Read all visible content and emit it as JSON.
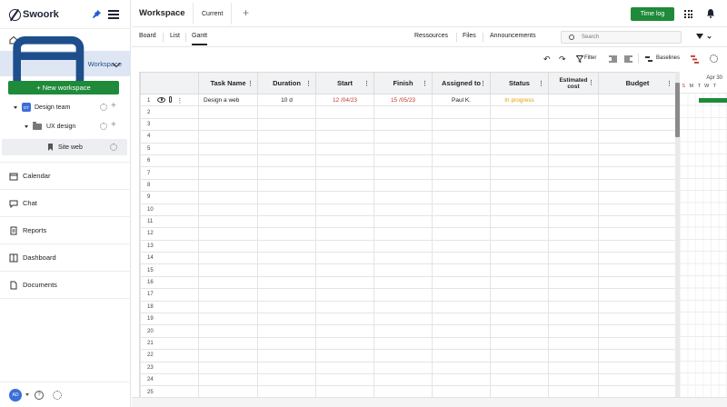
{
  "app": {
    "name": "Swoork"
  },
  "sidebar": {
    "desk": "Desk",
    "workspace": "Workspace",
    "new_workspace": "+  New workspace",
    "tree": {
      "team_badge": "DT",
      "team": "Design team",
      "folder": "UX design",
      "site": "Site web"
    },
    "items": [
      {
        "label": "Calendar",
        "icon": "calendar-icon"
      },
      {
        "label": "Chat",
        "icon": "chat-icon"
      },
      {
        "label": "Reports",
        "icon": "reports-icon"
      },
      {
        "label": "Dashboard",
        "icon": "dashboard-icon"
      },
      {
        "label": "Documents",
        "icon": "documents-icon"
      }
    ],
    "user_initials": "AD",
    "help_glyph": "?"
  },
  "header": {
    "title": "Workspace",
    "tab_current": "Current",
    "tab_add": "+",
    "time_log": "Time log"
  },
  "views": {
    "board": "Board",
    "list": "List",
    "gantt": "Gantt",
    "resources": "Ressources",
    "files": "Files",
    "announcements": "Announcements",
    "search_placeholder": "Search"
  },
  "toolbar": {
    "undo": "↶",
    "redo": "↷",
    "filter": "Filter",
    "baselines": "Baselines"
  },
  "table": {
    "columns": {
      "task_name": "Task Name",
      "duration": "Duration",
      "start": "Start",
      "finish": "Finish",
      "assigned_to": "Assigned to",
      "status": "Status",
      "estimated_cost": "Estimated cost",
      "budget": "Budget"
    },
    "rows": [
      {
        "n": "1",
        "task": "Design a web",
        "duration": "10 d",
        "start": "12 /04/23",
        "finish": "15 /05/23",
        "assigned": "Paul K.",
        "status": "In progress"
      },
      {
        "n": "2"
      },
      {
        "n": "3"
      },
      {
        "n": "4"
      },
      {
        "n": "5"
      },
      {
        "n": "6"
      },
      {
        "n": "7"
      },
      {
        "n": "8"
      },
      {
        "n": "9"
      },
      {
        "n": "10"
      },
      {
        "n": "11"
      },
      {
        "n": "12"
      },
      {
        "n": "13"
      },
      {
        "n": "14"
      },
      {
        "n": "15"
      },
      {
        "n": "16"
      },
      {
        "n": "17"
      },
      {
        "n": "18"
      },
      {
        "n": "19"
      },
      {
        "n": "20"
      },
      {
        "n": "21"
      },
      {
        "n": "22"
      },
      {
        "n": "23"
      },
      {
        "n": "24"
      },
      {
        "n": "25"
      }
    ]
  },
  "gantt": {
    "week_label": "Apr 30",
    "days": [
      "S",
      "M",
      "T",
      "W",
      "T"
    ],
    "bar_color": "#1e8a3a"
  },
  "colors": {
    "accent_green": "#1e8a3a",
    "date_red": "#c0392b",
    "status_orange": "#e69b00",
    "active_nav": "#dfe6f3"
  }
}
